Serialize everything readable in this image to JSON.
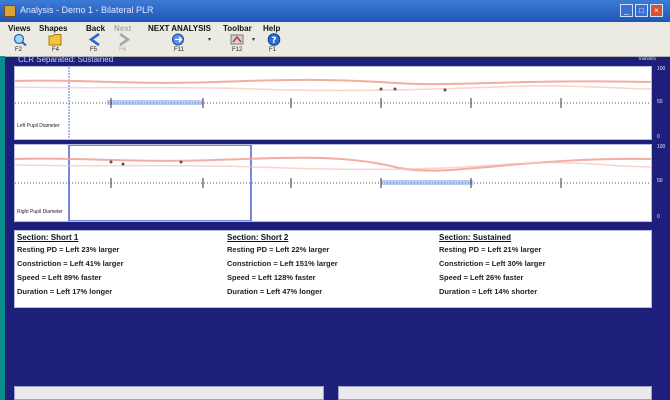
{
  "window": {
    "title": "Analysis - Demo 1 - Bilateral PLR",
    "controls": [
      "_",
      "□",
      "×"
    ]
  },
  "toolbar": {
    "items": [
      {
        "label": "Views",
        "key": "F2",
        "icon": "views-icon"
      },
      {
        "label": "Shapes",
        "key": "F4",
        "icon": "shapes-icon"
      },
      {
        "label": "Back",
        "key": "F5",
        "icon": "back-arrow-icon"
      },
      {
        "label": "Next",
        "key": "F6",
        "icon": "next-arrow-icon",
        "disabled": true
      },
      {
        "label": "NEXT ANALYSIS",
        "key": "F11",
        "icon": "next-analysis-icon"
      },
      {
        "label": "Toolbar",
        "key": "F12",
        "icon": "toolbar-icon"
      },
      {
        "label": "Help",
        "key": "F1",
        "icon": "help-icon"
      }
    ]
  },
  "main": {
    "header": "CLR Separated: Sustained",
    "header_right": "Values",
    "traces": [
      {
        "label": "Left Pupil Diameter",
        "scale_top": "100",
        "scale_mid": "50",
        "scale_bottom": "0"
      },
      {
        "label": "Right Pupil Diameter",
        "scale_top": "100",
        "scale_mid": "50",
        "scale_bottom": "0"
      }
    ]
  },
  "results": {
    "sections": [
      {
        "title": "Section: Short 1",
        "lines": [
          "Resting PD = Left 23% larger",
          "Constriction = Left 41% larger",
          "Speed = Left 89% faster",
          "Duration = Left 17% longer"
        ]
      },
      {
        "title": "Section: Short 2",
        "lines": [
          "Resting PD = Left 22% larger",
          "Constriction = Left 151% larger",
          "Speed = Left 128% faster",
          "Duration = Left 47% longer"
        ]
      },
      {
        "title": "Section: Sustained",
        "lines": [
          "Resting PD = Left 21% larger",
          "Constriction = Left 30% larger",
          "Speed = Left 26% faster",
          "Duration = Left 14% shorter"
        ]
      }
    ]
  },
  "colors": {
    "background": "#1d1f7a",
    "trace_line": "#f0a090",
    "selection": "#7da3e6"
  }
}
